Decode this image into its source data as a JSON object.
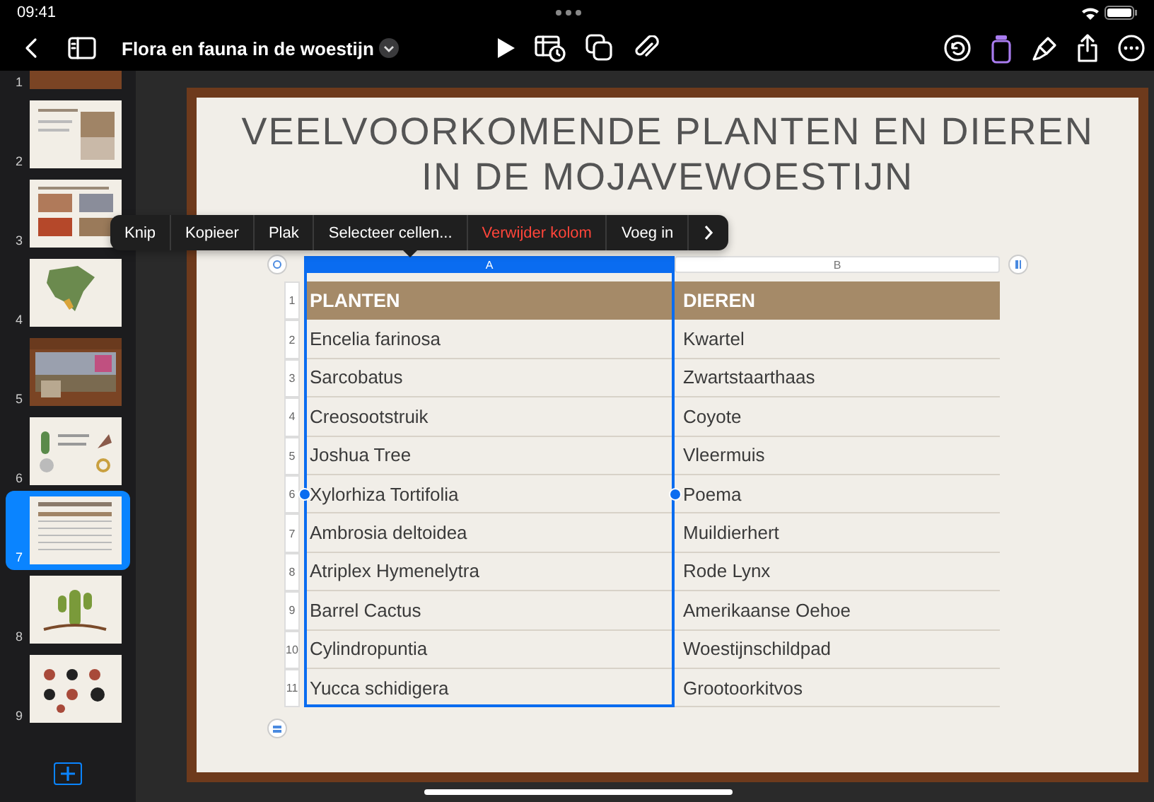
{
  "status_bar": {
    "time": "09:41"
  },
  "toolbar": {
    "title": "Flora en fauna in de woestijn"
  },
  "slides": [
    {
      "number": "1",
      "selected": false,
      "kind": "dark"
    },
    {
      "number": "2",
      "selected": false,
      "kind": "light"
    },
    {
      "number": "3",
      "selected": false,
      "kind": "light"
    },
    {
      "number": "4",
      "selected": false,
      "kind": "light"
    },
    {
      "number": "5",
      "selected": false,
      "kind": "dark"
    },
    {
      "number": "6",
      "selected": false,
      "kind": "light"
    },
    {
      "number": "7",
      "selected": true,
      "kind": "light"
    },
    {
      "number": "8",
      "selected": false,
      "kind": "light"
    },
    {
      "number": "9",
      "selected": false,
      "kind": "light"
    }
  ],
  "slide": {
    "title": "VEELVOORKOMENDE PLANTEN EN DIEREN IN DE MOJAVEWOESTIJN",
    "table": {
      "columns": [
        {
          "label": "A",
          "selected": true
        },
        {
          "label": "B",
          "selected": false
        }
      ],
      "rows": [
        {
          "number": "1",
          "kind": "header",
          "cells": [
            "PLANTEN",
            "DIEREN"
          ]
        },
        {
          "number": "2",
          "kind": "body",
          "cells": [
            "Encelia farinosa",
            "Kwartel"
          ]
        },
        {
          "number": "3",
          "kind": "body",
          "cells": [
            "Sarcobatus",
            "Zwartstaarthaas"
          ]
        },
        {
          "number": "4",
          "kind": "body",
          "cells": [
            "Creosootstruik",
            "Coyote"
          ]
        },
        {
          "number": "5",
          "kind": "body",
          "cells": [
            "Joshua Tree",
            "Vleermuis"
          ]
        },
        {
          "number": "6",
          "kind": "body",
          "cells": [
            "Xylorhiza Tortifolia",
            "Poema"
          ]
        },
        {
          "number": "7",
          "kind": "body",
          "cells": [
            "Ambrosia deltoidea",
            "Muildierhert"
          ]
        },
        {
          "number": "8",
          "kind": "body",
          "cells": [
            "Atriplex Hymenelytra",
            "Rode Lynx"
          ]
        },
        {
          "number": "9",
          "kind": "body",
          "cells": [
            "Barrel Cactus",
            "Amerikaanse Oehoe"
          ]
        },
        {
          "number": "10",
          "kind": "body",
          "cells": [
            "Cylindropuntia",
            "Woestijnschildpad"
          ]
        },
        {
          "number": "11",
          "kind": "body",
          "cells": [
            "Yucca schidigera",
            "Grootoorkitvos"
          ]
        }
      ]
    }
  },
  "context_menu": {
    "items": [
      {
        "label": "Knip",
        "kind": "normal"
      },
      {
        "label": "Kopieer",
        "kind": "normal"
      },
      {
        "label": "Plak",
        "kind": "normal"
      },
      {
        "label": "Selecteer cellen...",
        "kind": "normal"
      },
      {
        "label": "Verwijder kolom",
        "kind": "destructive"
      },
      {
        "label": "Voeg in",
        "kind": "normal"
      },
      {
        "kind": "more"
      }
    ]
  }
}
